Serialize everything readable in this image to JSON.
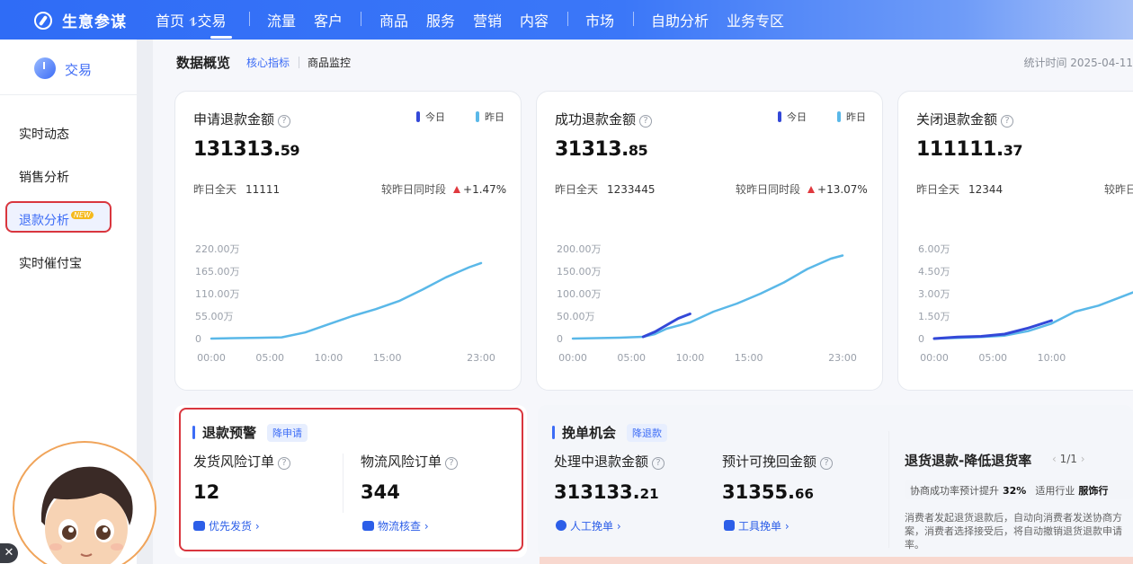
{
  "app": {
    "name": "生意参谋"
  },
  "nav": {
    "items": [
      {
        "label": "首页"
      },
      {
        "label": "交易",
        "prefix": "⥮"
      },
      {
        "label": "流量"
      },
      {
        "label": "客户"
      },
      {
        "label": "商品"
      },
      {
        "label": "服务"
      },
      {
        "label": "营销"
      },
      {
        "label": "内容"
      },
      {
        "label": "市场"
      },
      {
        "label": "自助分析"
      },
      {
        "label": "业务专区"
      }
    ]
  },
  "sidebar": {
    "title": "交易",
    "items": [
      {
        "label": "实时动态"
      },
      {
        "label": "销售分析"
      },
      {
        "label": "退款分析",
        "badge": "NEW",
        "active": true
      },
      {
        "label": "实时催付宝"
      }
    ]
  },
  "page": {
    "title": "数据概览",
    "tabs": [
      {
        "label": "核心指标",
        "active": true
      },
      {
        "label": "商品监控"
      }
    ],
    "stat_time": "统计时间 2025-04-11"
  },
  "legend": {
    "today": "今日",
    "yesterday": "昨日",
    "today_color": "#3348d8",
    "yesterday_color": "#5ab8e8"
  },
  "cards": [
    {
      "title": "申请退款金额",
      "value_int": "131313.",
      "value_dec": "59",
      "yday_label": "昨日全天",
      "yday_value": "11111",
      "cmp_label": "较昨日同时段",
      "cmp_value": "+1.47%"
    },
    {
      "title": "成功退款金额",
      "value_int": "31313.",
      "value_dec": "85",
      "yday_label": "昨日全天",
      "yday_value": "1233445",
      "cmp_label": "较昨日同时段",
      "cmp_value": "+13.07%"
    },
    {
      "title": "关闭退款金额",
      "value_int": "111111.",
      "value_dec": "37",
      "yday_label": "昨日全天",
      "yday_value": "12344",
      "cmp_label": "较昨日同时段",
      "cmp_value": ""
    }
  ],
  "chart_data": [
    {
      "type": "line",
      "title": "申请退款金额",
      "x_ticks": [
        "00:00",
        "05:00",
        "10:00",
        "15:00",
        "23:00"
      ],
      "y_ticks": [
        "0",
        "55.00万",
        "110.00万",
        "165.00万",
        "220.00万"
      ],
      "ylim": [
        0,
        220
      ],
      "series": [
        {
          "name": "昨日",
          "x": [
            0,
            2,
            4,
            6,
            8,
            10,
            12,
            14,
            16,
            18,
            20,
            22,
            23
          ],
          "y": [
            0,
            1,
            2,
            3,
            15,
            35,
            55,
            72,
            92,
            120,
            150,
            175,
            185
          ]
        }
      ]
    },
    {
      "type": "line",
      "title": "成功退款金额",
      "x_ticks": [
        "00:00",
        "05:00",
        "10:00",
        "15:00",
        "23:00"
      ],
      "y_ticks": [
        "0",
        "50.00万",
        "100.00万",
        "150.00万",
        "200.00万"
      ],
      "ylim": [
        0,
        200
      ],
      "series": [
        {
          "name": "昨日",
          "x": [
            0,
            2,
            4,
            6,
            7,
            8,
            10,
            12,
            14,
            16,
            18,
            20,
            22,
            23
          ],
          "y": [
            0,
            1,
            2,
            4,
            10,
            22,
            36,
            60,
            78,
            100,
            125,
            155,
            178,
            185
          ]
        },
        {
          "name": "今日",
          "x": [
            6,
            7,
            8,
            9,
            10
          ],
          "y": [
            4,
            15,
            30,
            45,
            55
          ]
        }
      ]
    },
    {
      "type": "line",
      "title": "关闭退款金额",
      "x_ticks": [
        "00:00",
        "05:00",
        "10:00"
      ],
      "y_ticks": [
        "0",
        "1.50万",
        "3.00万",
        "4.50万",
        "6.00万"
      ],
      "ylim": [
        0,
        6
      ],
      "series": [
        {
          "name": "昨日",
          "x": [
            0,
            2,
            4,
            6,
            8,
            10,
            12,
            14,
            16,
            18,
            19
          ],
          "y": [
            0,
            0.05,
            0.1,
            0.2,
            0.5,
            1.0,
            1.8,
            2.2,
            2.8,
            3.4,
            3.8
          ]
        },
        {
          "name": "今日",
          "x": [
            0,
            2,
            4,
            6,
            8,
            10
          ],
          "y": [
            0,
            0.1,
            0.15,
            0.3,
            0.7,
            1.2
          ]
        }
      ]
    }
  ],
  "refund_warning": {
    "title": "退款预警",
    "tag": "降申请",
    "metrics": [
      {
        "label": "发货风险订单",
        "value": "12",
        "action": "优先发货"
      },
      {
        "label": "物流风险订单",
        "value": "344",
        "action": "物流核查"
      }
    ]
  },
  "save_order": {
    "title": "挽单机会",
    "tag": "降退款",
    "metrics": [
      {
        "label": "处理中退款金额",
        "value_int": "313133.",
        "value_dec": "21",
        "action": "人工挽单"
      },
      {
        "label": "预计可挽回金额",
        "value_int": "31355.",
        "value_dec": "66",
        "action": "工具挽单"
      }
    ],
    "panel": {
      "title": "退货退款-降低退货率",
      "pager": "1/1",
      "rate_label": "协商成功率预计提升",
      "rate_value": "32%",
      "industry_label": "适用行业",
      "industry_value": "服饰行",
      "desc": "消费者发起退货退款后，自动向消费者发送协商方案，消费者选择接受后，将自动撤销退货退款申请率。"
    }
  }
}
